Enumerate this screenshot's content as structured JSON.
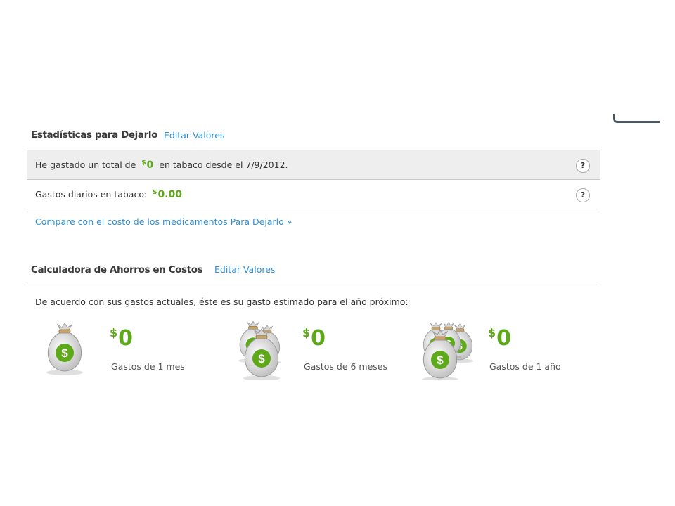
{
  "stats": {
    "title": "Estadísticas para Dejarlo",
    "edit_label": "Editar Valores",
    "rows": [
      {
        "prefix": "He gastado un total de",
        "currency": "$",
        "amount": "0",
        "suffix": "en tabaco desde el 7/9/2012.",
        "help": "?"
      },
      {
        "prefix": "Gastos diarios en tabaco:",
        "currency": "$",
        "amount": "0.00",
        "suffix": "",
        "help": "?"
      }
    ],
    "compare_link": "Compare con el costo de los medicamentos Para Dejarlo »"
  },
  "calculator": {
    "title": "Calculadora de Ahorros en Costos",
    "edit_label": "Editar Valores",
    "description": "De acuerdo con sus gastos actuales, éste es su gasto estimado para el año próximo:",
    "cards": [
      {
        "currency": "$",
        "amount": "0",
        "label": "Gastos de 1 mes",
        "icon": "money-bag-icon"
      },
      {
        "currency": "$",
        "amount": "0",
        "label": "Gastos de 6 meses",
        "icon": "money-bags-stack-icon"
      },
      {
        "currency": "$",
        "amount": "0",
        "label": "Gastos de 1 año",
        "icon": "money-bags-pile-icon"
      }
    ]
  },
  "colors": {
    "accent_green": "#5ea919",
    "link_blue": "#2f8ed1"
  }
}
